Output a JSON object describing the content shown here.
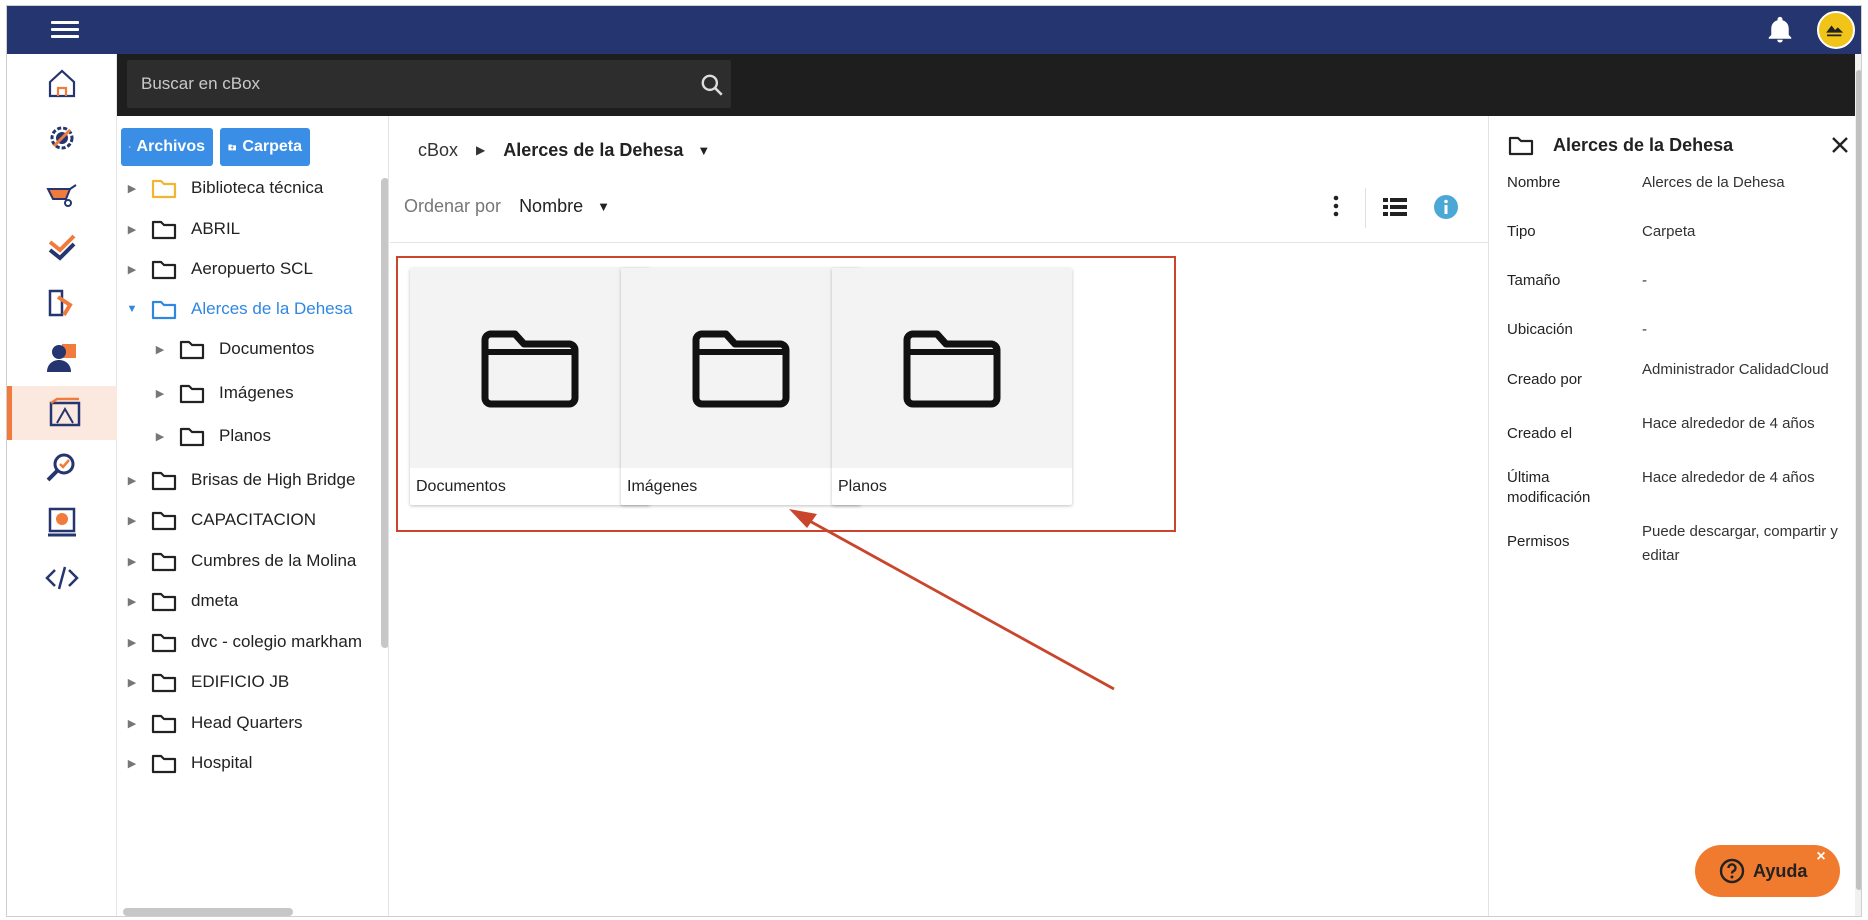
{
  "topbar": {
    "menu_icon": "hamburger-icon",
    "notifications_icon": "bell-icon",
    "avatar_icon": "user-avatar"
  },
  "rail": {
    "items": [
      {
        "name": "home",
        "icon": "home-icon"
      },
      {
        "name": "settings",
        "icon": "gear-icon"
      },
      {
        "name": "construction",
        "icon": "wheelbarrow-icon"
      },
      {
        "name": "quality",
        "icon": "check-stack-icon"
      },
      {
        "name": "exchange",
        "icon": "exchange-icon"
      },
      {
        "name": "people",
        "icon": "user-icon"
      },
      {
        "name": "cbox",
        "icon": "blueprint-icon"
      },
      {
        "name": "inspection",
        "icon": "magnifier-icon"
      },
      {
        "name": "finance",
        "icon": "money-icon"
      },
      {
        "name": "developer",
        "icon": "code-icon"
      }
    ],
    "active": "cbox",
    "colors": {
      "active_bg": "#fbe9e0",
      "active_bar": "#f07b3d",
      "blue": "#24356f",
      "orange": "#f07b3d"
    }
  },
  "search": {
    "placeholder": "Buscar en cBox",
    "value": ""
  },
  "tree": {
    "buttons": {
      "files": "Archivos",
      "folder": "Carpeta"
    },
    "items": [
      {
        "label": "Biblioteca técnica",
        "level": 0,
        "expanded": false,
        "special": true
      },
      {
        "label": "ABRIL",
        "level": 0,
        "expanded": false
      },
      {
        "label": "Aeropuerto SCL",
        "level": 0,
        "expanded": false
      },
      {
        "label": "Alerces de la Dehesa",
        "level": 0,
        "expanded": true,
        "active": true
      },
      {
        "label": "Documentos",
        "level": 1,
        "expanded": false
      },
      {
        "label": "Imágenes",
        "level": 1,
        "expanded": false
      },
      {
        "label": "Planos",
        "level": 1,
        "expanded": false
      },
      {
        "label": "Brisas de High Bridge",
        "level": 0,
        "expanded": false
      },
      {
        "label": "CAPACITACION",
        "level": 0,
        "expanded": false
      },
      {
        "label": "Cumbres de la Molina",
        "level": 0,
        "expanded": false
      },
      {
        "label": "dmeta",
        "level": 0,
        "expanded": false
      },
      {
        "label": "dvc - colegio markham",
        "level": 0,
        "expanded": false
      },
      {
        "label": "EDIFICIO JB",
        "level": 0,
        "expanded": false
      },
      {
        "label": "Head Quarters",
        "level": 0,
        "expanded": false
      },
      {
        "label": "Hospital",
        "level": 0,
        "expanded": false
      }
    ]
  },
  "breadcrumb": {
    "root": "cBox",
    "current": "Alerces de la Dehesa"
  },
  "sort": {
    "label": "Ordenar por",
    "value": "Nombre"
  },
  "folders": [
    {
      "name": "Documentos"
    },
    {
      "name": "Imágenes"
    },
    {
      "name": "Planos"
    }
  ],
  "details": {
    "title": "Alerces de la Dehesa",
    "rows": [
      {
        "key": "Nombre",
        "value": "Alerces de la Dehesa"
      },
      {
        "key": "Tipo",
        "value": "Carpeta"
      },
      {
        "key": "Tamaño",
        "value": "-"
      },
      {
        "key": "Ubicación",
        "value": "-"
      },
      {
        "key": "Creado por",
        "value": "Administrador CalidadCloud"
      },
      {
        "key": "Creado el",
        "value": "Hace alrededor de 4 años"
      },
      {
        "key": "Última modificación",
        "value": "Hace alrededor de 4 años"
      },
      {
        "key": "Permisos",
        "value": "Puede descargar, compartir y editar"
      }
    ]
  },
  "help": {
    "label": "Ayuda",
    "close": "×"
  },
  "annotation": {
    "highlight_color": "#c9452b"
  }
}
